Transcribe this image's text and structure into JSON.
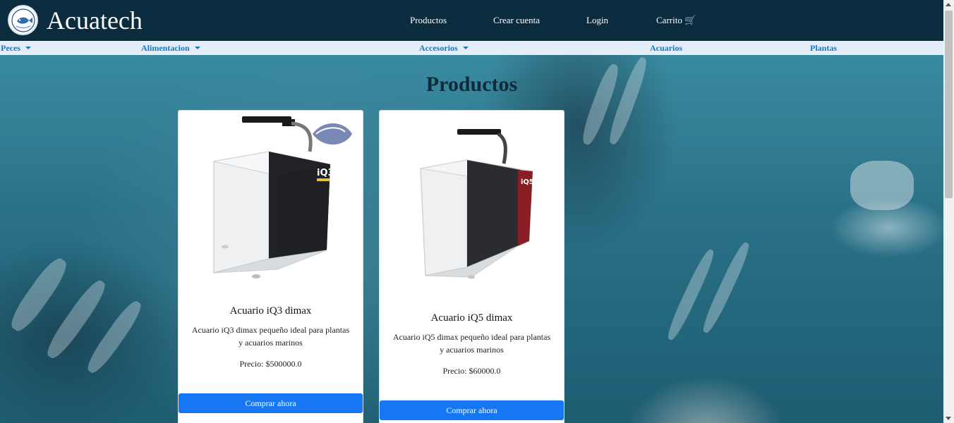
{
  "header": {
    "brand": "Acuatech",
    "logo_icon": "acuatech-fish-logo",
    "nav": [
      "Productos",
      "Crear cuenta",
      "Login",
      "Carrito 🛒"
    ]
  },
  "subnav": [
    {
      "label": "Peces",
      "dropdown": true
    },
    {
      "label": "Alimentacion",
      "dropdown": true
    },
    {
      "label": "Accesorios",
      "dropdown": true
    },
    {
      "label": "Acuarios",
      "dropdown": false
    },
    {
      "label": "Plantas",
      "dropdown": false
    }
  ],
  "main": {
    "title": "Productos",
    "products": [
      {
        "name": "Acuario iQ3 dimax",
        "description": "Acuario iQ3 dimax pequeño ideal para plantas y acuarios marinos",
        "price": "Precio: $500000.0",
        "button": "Comprar ahora",
        "tank_label": "iQ3"
      },
      {
        "name": "Acuario iQ5 dimax",
        "description": "Acuario iQ5 dimax pequeño ideal para plantas y acuarios marinos",
        "price": "Precio: $60000.0",
        "button": "Comprar ahora",
        "tank_label": "iQ5"
      }
    ]
  },
  "colors": {
    "navbar": "#0b2b3f",
    "subnav": "#e3eef8",
    "link": "#1677c8",
    "button": "#1677f3"
  }
}
